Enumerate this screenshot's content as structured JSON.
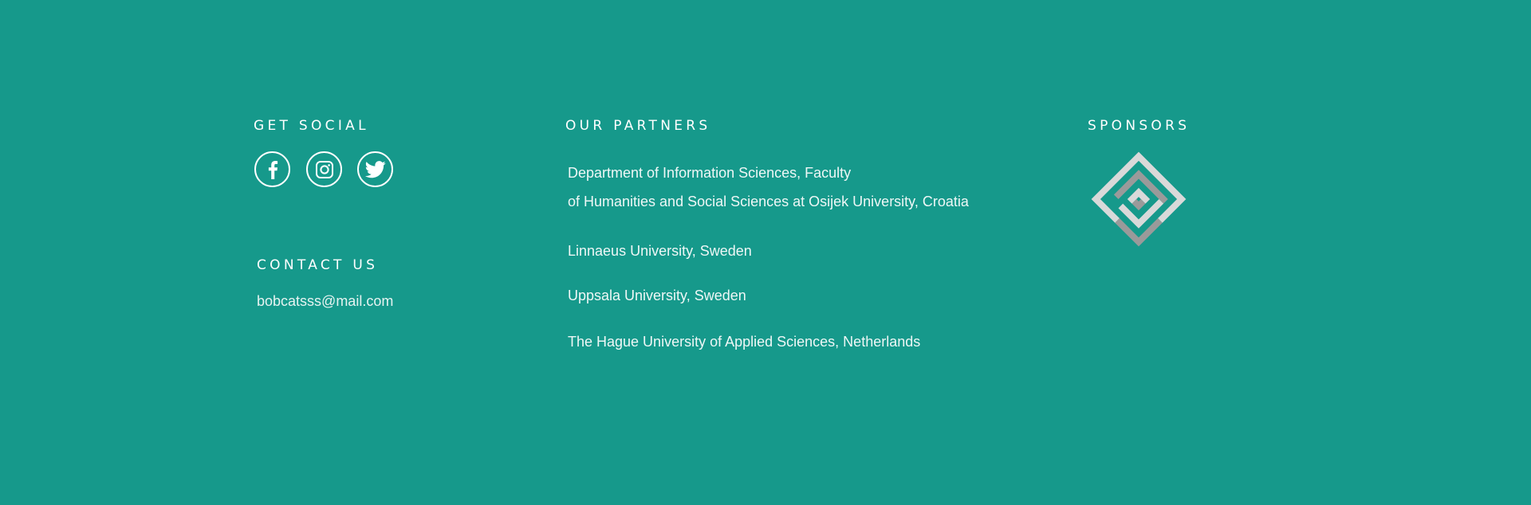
{
  "social": {
    "heading": "GET SOCIAL",
    "links": [
      {
        "name": "facebook",
        "icon": "facebook-icon"
      },
      {
        "name": "instagram",
        "icon": "instagram-icon"
      },
      {
        "name": "twitter",
        "icon": "twitter-icon"
      }
    ]
  },
  "contact": {
    "heading": "CONTACT US",
    "email": "bobcatsss@mail.com"
  },
  "partners": {
    "heading": "OUR PARTNERS",
    "items": [
      "Department of Information Sciences, Faculty",
      "of Humanities and Social Sciences at Osijek University, Croatia",
      "Linnaeus University, Sweden",
      "Uppsala University, Sweden",
      "The Hague University of Applied Sciences, Netherlands"
    ]
  },
  "sponsors": {
    "heading": "SPONSORS",
    "logo_icon": "maze-diamond-logo"
  },
  "colors": {
    "background": "#16998b",
    "text": "#ffffff",
    "logo_light": "#d9d9d9",
    "logo_dark": "#9a9a9a"
  }
}
